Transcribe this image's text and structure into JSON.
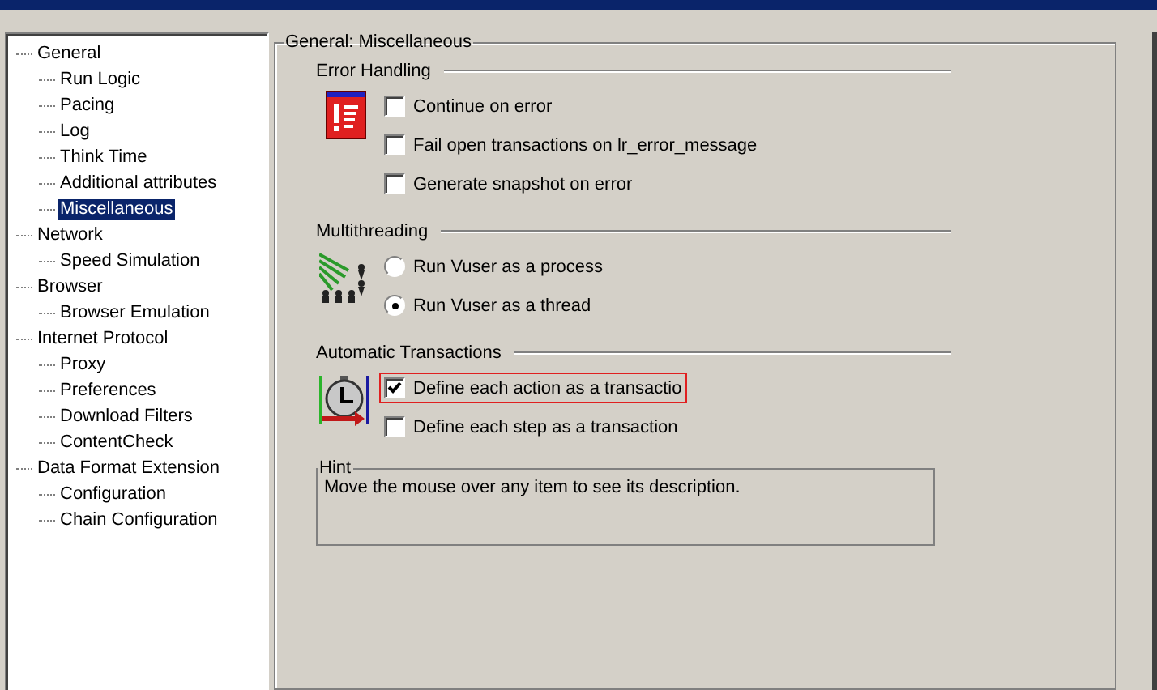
{
  "tree": [
    {
      "label": "General",
      "selected": false,
      "children": [
        {
          "label": "Run Logic",
          "selected": false
        },
        {
          "label": "Pacing",
          "selected": false
        },
        {
          "label": "Log",
          "selected": false
        },
        {
          "label": "Think Time",
          "selected": false
        },
        {
          "label": "Additional attributes",
          "selected": false
        },
        {
          "label": "Miscellaneous",
          "selected": true
        }
      ]
    },
    {
      "label": "Network",
      "selected": false,
      "children": [
        {
          "label": "Speed Simulation",
          "selected": false
        }
      ]
    },
    {
      "label": "Browser",
      "selected": false,
      "children": [
        {
          "label": "Browser Emulation",
          "selected": false
        }
      ]
    },
    {
      "label": "Internet Protocol",
      "selected": false,
      "children": [
        {
          "label": "Proxy",
          "selected": false
        },
        {
          "label": "Preferences",
          "selected": false
        },
        {
          "label": "Download Filters",
          "selected": false
        },
        {
          "label": "ContentCheck",
          "selected": false
        }
      ]
    },
    {
      "label": "Data Format Extension",
      "selected": false,
      "children": [
        {
          "label": "Configuration",
          "selected": false
        },
        {
          "label": "Chain Configuration",
          "selected": false
        }
      ]
    }
  ],
  "page_title": "General: Miscellaneous",
  "sections": [
    {
      "title": "Error Handling",
      "options": [
        {
          "kind": "checkbox",
          "label": "Continue on error",
          "checked": false,
          "highlighted": false
        },
        {
          "kind": "checkbox",
          "label": "Fail open transactions on lr_error_message",
          "checked": false,
          "highlighted": false
        },
        {
          "kind": "checkbox",
          "label": "Generate snapshot on error",
          "checked": false,
          "highlighted": false
        }
      ]
    },
    {
      "title": "Multithreading",
      "options": [
        {
          "kind": "radio",
          "label": "Run Vuser as a process",
          "checked": false,
          "highlighted": false
        },
        {
          "kind": "radio",
          "label": "Run Vuser as a thread",
          "checked": true,
          "highlighted": false
        }
      ]
    },
    {
      "title": "Automatic Transactions",
      "options": [
        {
          "kind": "checkbox",
          "label": "Define each action as a transactio",
          "checked": true,
          "highlighted": true
        },
        {
          "kind": "checkbox",
          "label": "Define each step as a transaction",
          "checked": false,
          "highlighted": false
        }
      ]
    }
  ],
  "hint": {
    "title": "Hint",
    "text": "Move the mouse over any item to see its description."
  }
}
